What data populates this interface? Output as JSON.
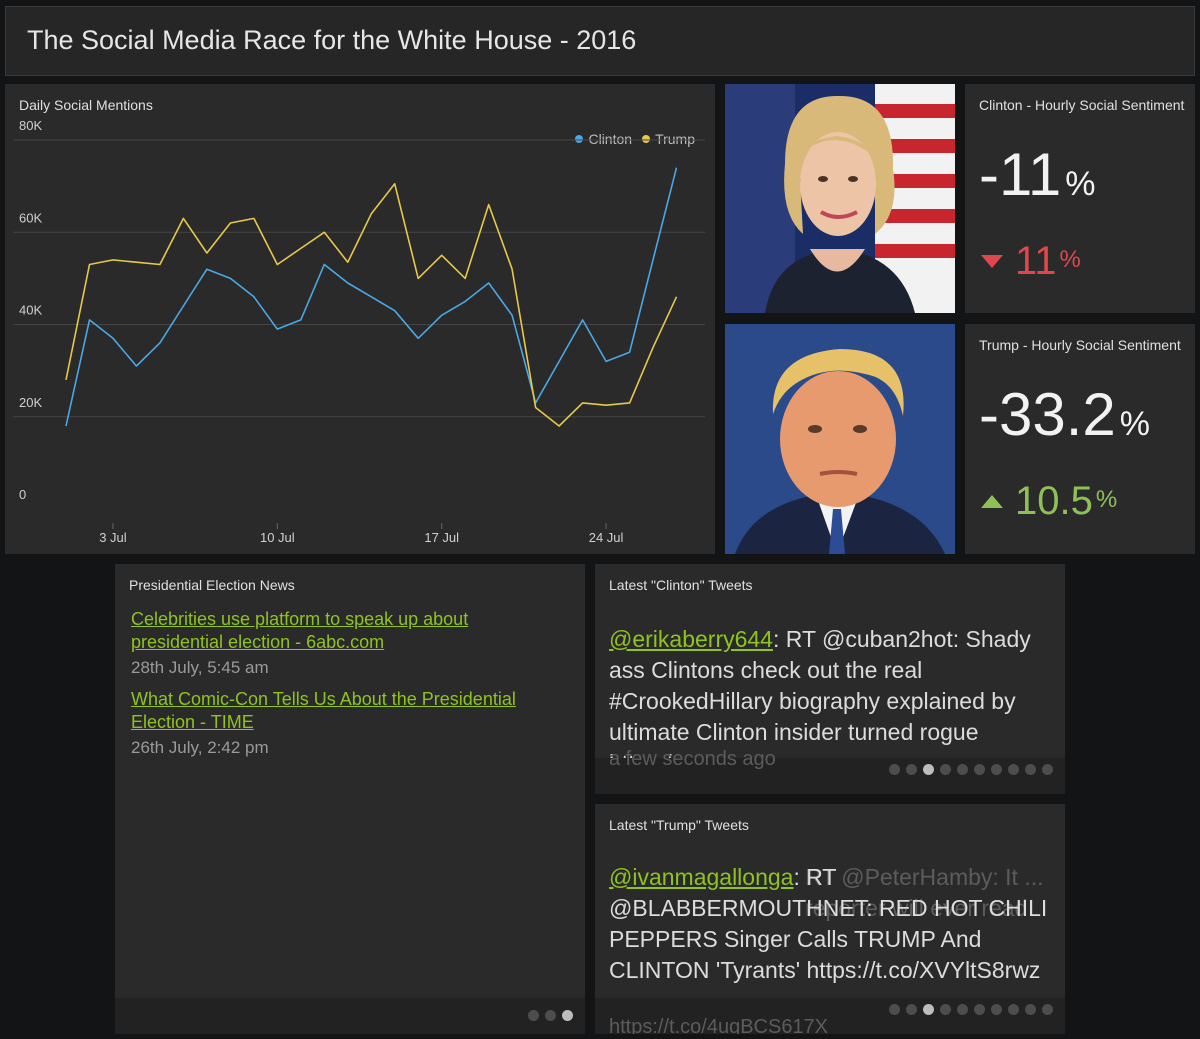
{
  "header": {
    "title": "The Social Media Race for the White House - 2016"
  },
  "mentions_panel": {
    "label": "Daily Social Mentions"
  },
  "clinton_sentiment": {
    "label": "Clinton - Hourly Social Sentiment",
    "value": "-11",
    "unit": "%",
    "delta": "11",
    "delta_unit": "%",
    "delta_direction": "down",
    "delta_color": "#e0474c"
  },
  "trump_sentiment": {
    "label": "Trump - Hourly Social Sentiment",
    "value": "-33.2",
    "unit": "%",
    "delta": "10.5",
    "delta_unit": "%",
    "delta_direction": "up",
    "delta_color": "#8fc057"
  },
  "photos": {
    "clinton": "clinton-portrait",
    "trump": "trump-portrait"
  },
  "news": {
    "label": "Presidential Election News",
    "items": [
      {
        "title": "Celebrities use platform to speak up about presidential election - 6abc.com",
        "date": "28th July, 5:45 am"
      },
      {
        "title": "What Comic-Con Tells Us About the Presidential Election - TIME",
        "date": "26th July, 2:42 pm"
      }
    ],
    "pager": {
      "count": 3,
      "active": 2
    }
  },
  "clinton_tweets": {
    "label": "Latest \"Clinton\" Tweets",
    "ghost_text": "@...Th...olde...ing.li... Why...sh...ng...ill...lint...rt...can...? https://t.co/...E... a few seconds ago",
    "ghost_time": "a few seconds ago",
    "user": "@erikaberry644",
    "text": ": RT @cuban2hot: Shady ass Clintons check out the real #CrookedHillary biography explained by ultimate Clinton insider turned rogue https:/...",
    "pager": {
      "count": 10,
      "active": 2
    }
  },
  "trump_tweets": {
    "label": "Latest \"Trump\" Tweets",
    "ghost_text": "RT @PeterHamby: It ... reporter will ever read",
    "ghost_link": "https://t.co/4ugBCS617X",
    "user": "@ivanmagallonga",
    "text": ": RT @BLABBERMOUTHNET: RED HOT CHILI PEPPERS Singer Calls TRUMP And CLINTON 'Tyrants' https://t.co/XVYltS8rwz",
    "pager": {
      "count": 10,
      "active": 2
    }
  },
  "chart_data": {
    "type": "line",
    "title": "Daily Social Mentions",
    "x_tick_labels": [
      "3 Jul",
      "10 Jul",
      "17 Jul",
      "24 Jul"
    ],
    "x_tick_days": [
      3,
      10,
      17,
      24
    ],
    "y_tick_labels": [
      "0",
      "20K",
      "40K",
      "60K",
      "80K"
    ],
    "ylim": [
      0,
      80000
    ],
    "xlim_days": [
      1,
      28
    ],
    "legend_position": "top-right",
    "grid": true,
    "x_days": [
      1,
      2,
      3,
      4,
      5,
      6,
      7,
      8,
      9,
      10,
      11,
      12,
      13,
      14,
      15,
      16,
      17,
      18,
      19,
      20,
      21,
      22,
      23,
      24,
      25,
      26,
      27,
      28
    ],
    "series": [
      {
        "name": "Clinton",
        "color": "#4aa8e6",
        "values": [
          18000,
          41000,
          37000,
          31000,
          36000,
          44000,
          52000,
          50000,
          46000,
          39000,
          41000,
          53000,
          49000,
          46000,
          43000,
          37000,
          42000,
          45000,
          49000,
          42000,
          23000,
          32000,
          41000,
          32000,
          34000,
          54000,
          74000,
          null
        ]
      },
      {
        "name": "Trump",
        "color": "#e6c94a",
        "values": [
          28000,
          53000,
          54000,
          53500,
          53000,
          63000,
          55500,
          62000,
          63000,
          53000,
          56500,
          60000,
          53500,
          64000,
          70500,
          50000,
          55000,
          50000,
          66000,
          52000,
          22000,
          18000,
          23000,
          22500,
          23000,
          35000,
          46000,
          null
        ]
      }
    ]
  }
}
